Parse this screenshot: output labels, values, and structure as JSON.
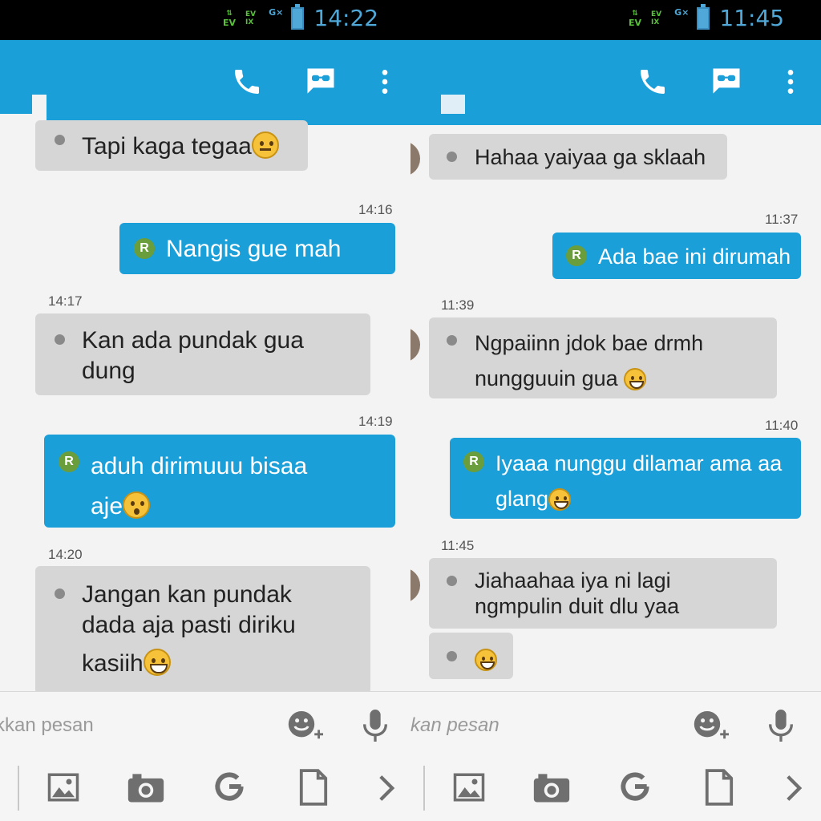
{
  "panes": {
    "left": {
      "status_time": "14:22",
      "status_net": "EV",
      "status_sig1": "EV",
      "status_sig2": "IX",
      "status_g": "G×",
      "input_placeholder": "kkan pesan",
      "messages": [
        {
          "text": "Tapi kaga tegaa",
          "emoji": "thinking"
        },
        {
          "time": "14:16",
          "text": "Nangis gue mah",
          "badge": "R"
        },
        {
          "time": "14:17",
          "line1": "Kan ada pundak gua",
          "line2": "dung"
        },
        {
          "time": "14:19",
          "line1": "aduh dirimuuu bisaa",
          "line2": "aje",
          "badge": "R",
          "emoji": "surprised"
        },
        {
          "time": "14:20",
          "line1": "Jangan kan pundak",
          "line2": "dada aja pasti diriku",
          "line3": "kasiih",
          "emoji": "grin"
        }
      ]
    },
    "right": {
      "status_time": "11:45",
      "status_net": "EV",
      "status_sig1": "EV",
      "status_sig2": "IX",
      "status_g": "G×",
      "input_placeholder": "kan pesan",
      "messages": [
        {
          "text": "Hahaa yaiyaa ga sklaah"
        },
        {
          "time": "11:37",
          "text": "Ada bae ini dirumah",
          "badge": "R"
        },
        {
          "time": "11:39",
          "line1": "Ngpaiinn jdok bae drmh",
          "line2": "nungguuin gua",
          "emoji": "grin"
        },
        {
          "time": "11:40",
          "line1": "Iyaaa nunggu dilamar ama aa",
          "line2": "glang",
          "badge": "R",
          "emoji": "laughing"
        },
        {
          "time": "11:45",
          "line1": "Jiahaahaa iya ni lagi",
          "line2": "ngmpulin duit dlu yaa"
        },
        {
          "emoji": "grin"
        }
      ]
    }
  },
  "icons": {
    "call": "phone-icon",
    "chat_mode": "message-mode-icon",
    "menu": "more-vert-icon",
    "emoji": "emoji-add-icon",
    "mic": "microphone-icon",
    "gallery": "image-icon",
    "camera": "camera-icon",
    "google": "google-icon",
    "file": "file-icon",
    "next": "chevron-right-icon"
  },
  "colors": {
    "appbar": "#1b9fd9",
    "outgoing_bubble": "#1b9fd9",
    "incoming_bubble": "#d6d6d6",
    "background": "#f3f3f3",
    "status_green": "#59c13b",
    "status_blue": "#4fa8d8"
  }
}
